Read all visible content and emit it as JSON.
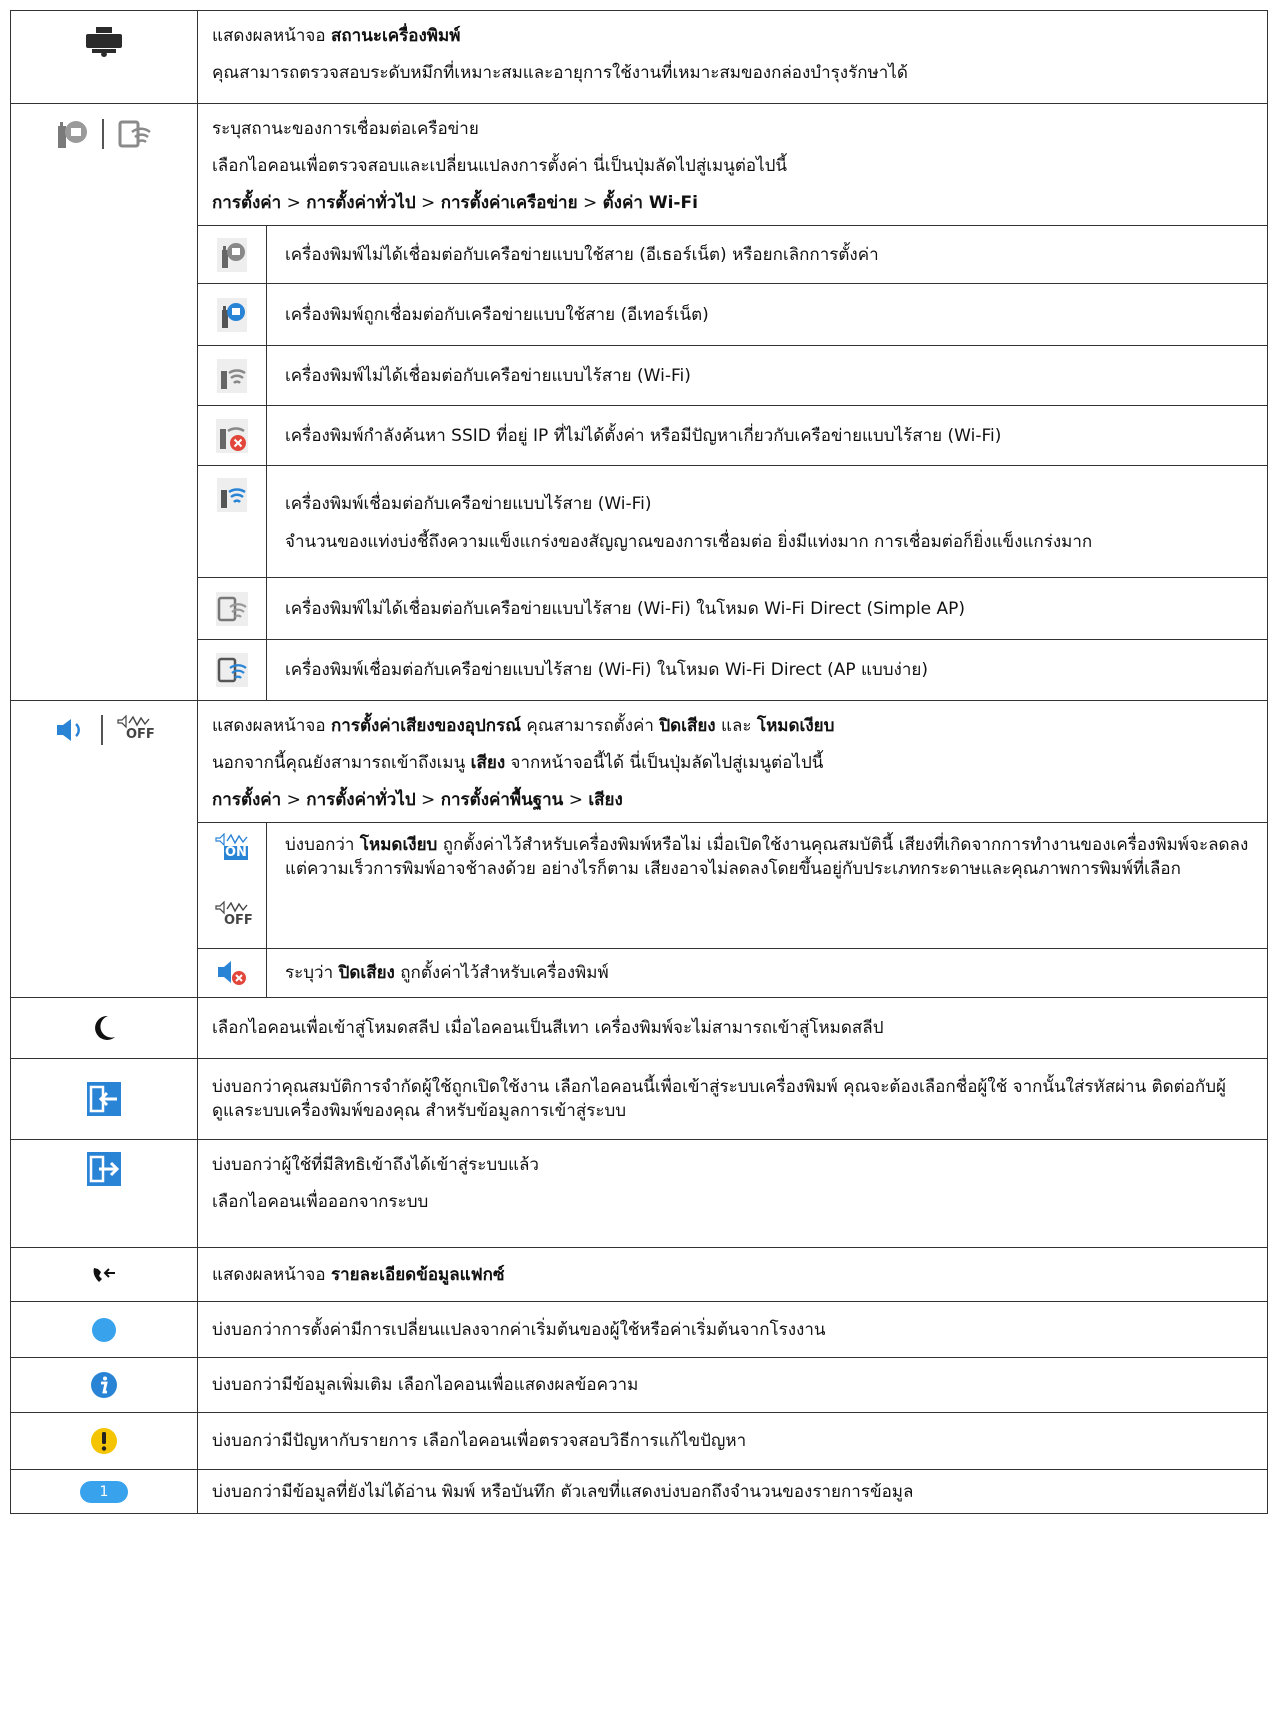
{
  "rows": {
    "status": {
      "l1_prefix": "แสดงผลหน้าจอ ",
      "l1_bold": "สถานะเครื่องพิมพ์",
      "l2": "คุณสามารถตรวจสอบระดับหมึกที่เหมาะสมและอายุการใช้งานที่เหมาะสมของกล่องบำรุงรักษาได้"
    },
    "network": {
      "l1": "ระบุสถานะของการเชื่อมต่อเครือข่าย",
      "l2": "เลือกไอคอนเพื่อตรวจสอบและเปลี่ยนแปลงการตั้งค่า นี่เป็นปุ่มลัดไปสู่เมนูต่อไปนี้",
      "path": [
        "การตั้งค่า",
        "การตั้งค่าทั่วไป",
        "การตั้งค่าเครือข่าย",
        "ตั้งค่า Wi-Fi"
      ],
      "sep": " > ",
      "sub": [
        "เครื่องพิมพ์ไม่ได้เชื่อมต่อกับเครือข่ายแบบใช้สาย (อีเธอร์เน็ต) หรือยกเลิกการตั้งค่า",
        "เครื่องพิมพ์ถูกเชื่อมต่อกับเครือข่ายแบบใช้สาย (อีเทอร์เน็ต)",
        "เครื่องพิมพ์ไม่ได้เชื่อมต่อกับเครือข่ายแบบไร้สาย (Wi-Fi)",
        "เครื่องพิมพ์กำลังค้นหา SSID ที่อยู่ IP ที่ไม่ได้ตั้งค่า หรือมีปัญหาเกี่ยวกับเครือข่ายแบบไร้สาย (Wi-Fi)",
        "เครื่องพิมพ์เชื่อมต่อกับเครือข่ายแบบไร้สาย (Wi-Fi)",
        "เครื่องพิมพ์ไม่ได้เชื่อมต่อกับเครือข่ายแบบไร้สาย (Wi-Fi) ในโหมด Wi-Fi Direct (Simple AP)",
        "เครื่องพิมพ์เชื่อมต่อกับเครือข่ายแบบไร้สาย (Wi-Fi) ในโหมด Wi-Fi Direct (AP แบบง่าย)"
      ],
      "sub_extra": "จำนวนของแท่งบ่งชี้ถึงความแข็งแกร่งของสัญญาณของการเชื่อมต่อ ยิ่งมีแท่งมาก การเชื่อมต่อก็ยิ่งแข็งแกร่งมาก"
    },
    "sound": {
      "l1_a": "แสดงผลหน้าจอ ",
      "l1_b": "การตั้งค่าเสียงของอุปกรณ์",
      "l1_c": " คุณสามารถตั้งค่า ",
      "l1_d": "ปิดเสียง",
      "l1_e": " และ ",
      "l1_f": "โหมดเงียบ",
      "l2_a": "นอกจากนี้คุณยังสามารถเข้าถึงเมนู ",
      "l2_b": "เสียง",
      "l2_c": " จากหน้าจอนี้ได้ นี่เป็นปุ่มลัดไปสู่เมนูต่อไปนี้",
      "path": [
        "การตั้งค่า",
        "การตั้งค่าทั่วไป",
        "การตั้งค่าพื้นฐาน",
        "เสียง"
      ],
      "quiet_a": "บ่งบอกว่า ",
      "quiet_b": "โหมดเงียบ",
      "quiet_c": " ถูกตั้งค่าไว้สำหรับเครื่องพิมพ์หรือไม่ เมื่อเปิดใช้งานคุณสมบัตินี้ เสียงที่เกิดจากการทำงานของเครื่องพิมพ์จะลดลง แต่ความเร็วการพิมพ์อาจช้าลงด้วย อย่างไรก็ตาม เสียงอาจไม่ลดลงโดยขึ้นอยู่กับประเภทกระดาษและคุณภาพการพิมพ์ที่เลือก",
      "mute_a": "ระบุว่า ",
      "mute_b": "ปิดเสียง",
      "mute_c": " ถูกตั้งค่าไว้สำหรับเครื่องพิมพ์",
      "icon_on": "ON",
      "icon_off": "OFF"
    },
    "sleep": "เลือกไอคอนเพื่อเข้าสู่โหมดสลีป เมื่อไอคอนเป็นสีเทา เครื่องพิมพ์จะไม่สามารถเข้าสู่โหมดสลีป",
    "login": "บ่งบอกว่าคุณสมบัติการจำกัดผู้ใช้ถูกเปิดใช้งาน เลือกไอคอนนี้เพื่อเข้าสู่ระบบเครื่องพิมพ์ คุณจะต้องเลือกชื่อผู้ใช้ จากนั้นใส่รหัสผ่าน ติดต่อกับผู้ดูแลระบบเครื่องพิมพ์ของคุณ สำหรับข้อมูลการเข้าสู่ระบบ",
    "logout": {
      "l1": "บ่งบอกว่าผู้ใช้ที่มีสิทธิเข้าถึงได้เข้าสู่ระบบแล้ว",
      "l2": "เลือกไอคอนเพื่อออกจากระบบ"
    },
    "fax": {
      "prefix": "แสดงผลหน้าจอ ",
      "bold": "รายละเอียดข้อมูลแฟกซ์"
    },
    "changed": "บ่งบอกว่าการตั้งค่ามีการเปลี่ยนแปลงจากค่าเริ่มต้นของผู้ใช้หรือค่าเริ่มต้นจากโรงงาน",
    "info": "บ่งบอกว่ามีข้อมูลเพิ่มเติม เลือกไอคอนเพื่อแสดงผลข้อความ",
    "warning": "บ่งบอกว่ามีปัญหากับรายการ เลือกไอคอนเพื่อตรวจสอบวิธีการแก้ไขปัญหา",
    "unread": {
      "text": "บ่งบอกว่ามีข้อมูลที่ยังไม่ได้อ่าน พิมพ์ หรือบันทึก ตัวเลขที่แสดงบ่งบอกถึงจำนวนของรายการข้อมูล",
      "badge": "1"
    }
  },
  "icons": {
    "printer": "printer-icon",
    "ethernet": "ethernet-icon",
    "wifi": "wifi-icon",
    "wifi_direct": "wifi-direct-icon",
    "speaker": "speaker-icon",
    "quiet_mode": "quiet-mode-icon",
    "sleep": "moon-icon",
    "login": "login-icon",
    "logout": "logout-icon",
    "fax": "fax-icon",
    "changed": "blue-dot-icon",
    "info": "info-icon",
    "warning": "warning-icon",
    "unread": "unread-badge-icon"
  },
  "colors": {
    "blue": "#2a84d6",
    "dot_blue": "#38a3ec",
    "warning_yellow": "#f5c400",
    "error_red": "#e2463a",
    "grey": "#8a8a8a",
    "dark": "#2b2b2b"
  }
}
